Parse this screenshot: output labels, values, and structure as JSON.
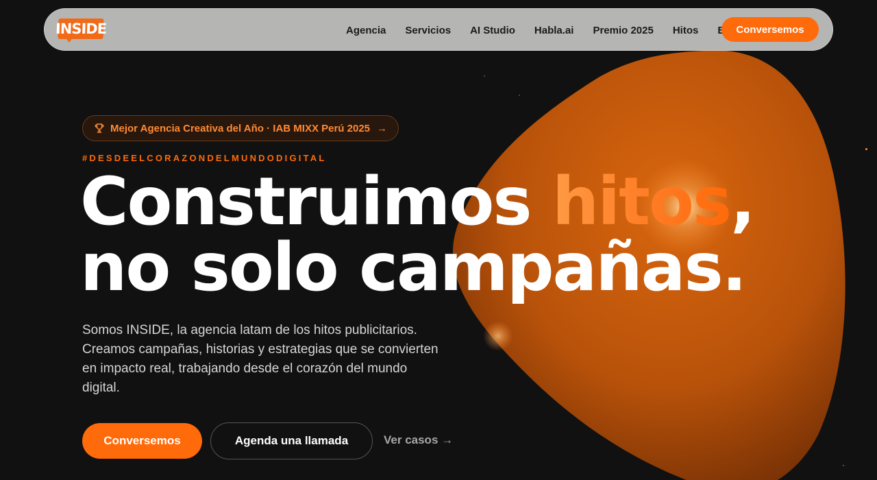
{
  "nav": {
    "logo_text": "INSIDE",
    "links": [
      {
        "label": "Agencia"
      },
      {
        "label": "Servicios"
      },
      {
        "label": "AI Studio"
      },
      {
        "label": "Habla.ai"
      },
      {
        "label": "Premio 2025"
      },
      {
        "label": "Hitos"
      },
      {
        "label": "Blog"
      }
    ],
    "cta_label": "Conversemos"
  },
  "hero": {
    "award_icon": "trophy-icon",
    "award_text": "Mejor Agencia Creativa del Año · IAB MIXX Perú 2025",
    "award_arrow": "→",
    "hashtag": "#DESDEELCORAZONDELMUNDODIGITAL",
    "headline": {
      "part1": "Construimos ",
      "accent": "hitos",
      "part2": ",",
      "line2": "no solo campañas."
    },
    "subtext": "Somos INSIDE, la agencia latam de los hitos publicitarios. Creamos campañas, historias y estrategias que se convierten en impacto real, trabajando desde el corazón del mundo digital.",
    "primary_cta": "Conversemos",
    "secondary_cta": "Agenda una llamada",
    "link_cases": "Ver casos →"
  },
  "colors": {
    "accent": "#ff6a0a",
    "background": "#111111",
    "nav_bg": "#b5b5b3"
  }
}
